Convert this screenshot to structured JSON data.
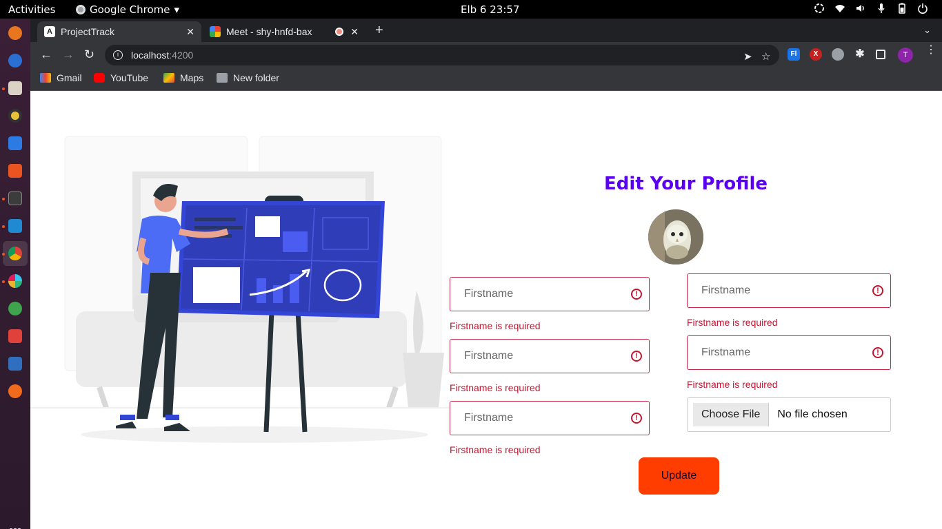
{
  "system_bar": {
    "activities": "Activities",
    "app_name": "Google Chrome",
    "clock": "Elb 6  23:57"
  },
  "browser": {
    "tabs": [
      {
        "title": "ProjectTrack",
        "favicon": "A"
      },
      {
        "title": "Meet - shy-hnfd-bax"
      }
    ],
    "address": {
      "host": "localhost",
      "port": ":4200"
    },
    "bookmarks": [
      {
        "label": "Gmail",
        "icon": "gmail-icon"
      },
      {
        "label": "YouTube",
        "icon": "youtube-icon"
      },
      {
        "label": "Maps",
        "icon": "maps-icon"
      },
      {
        "label": "New folder",
        "icon": "folder-icon"
      }
    ],
    "extensions": {
      "ext1": "Fl",
      "ext2": "X",
      "profile_initial": "T"
    }
  },
  "profile_form": {
    "title": "Edit Your Profile",
    "fields_left": [
      {
        "placeholder": "Firstname",
        "error": "Firstname is required"
      },
      {
        "placeholder": "Firstname",
        "error": "Firstname is required"
      },
      {
        "placeholder": "Firstname",
        "error": "Firstname is required"
      }
    ],
    "fields_right": [
      {
        "placeholder": "Firstname",
        "error": "Firstname is required"
      },
      {
        "placeholder": "Firstname",
        "error": "Firstname is required"
      }
    ],
    "file_input": {
      "button_label": "Choose File",
      "status": "No file chosen"
    },
    "submit_label": "Update"
  },
  "colors": {
    "title": "#5a00f0",
    "error": "#c4142f",
    "button": "#ff3d00"
  }
}
